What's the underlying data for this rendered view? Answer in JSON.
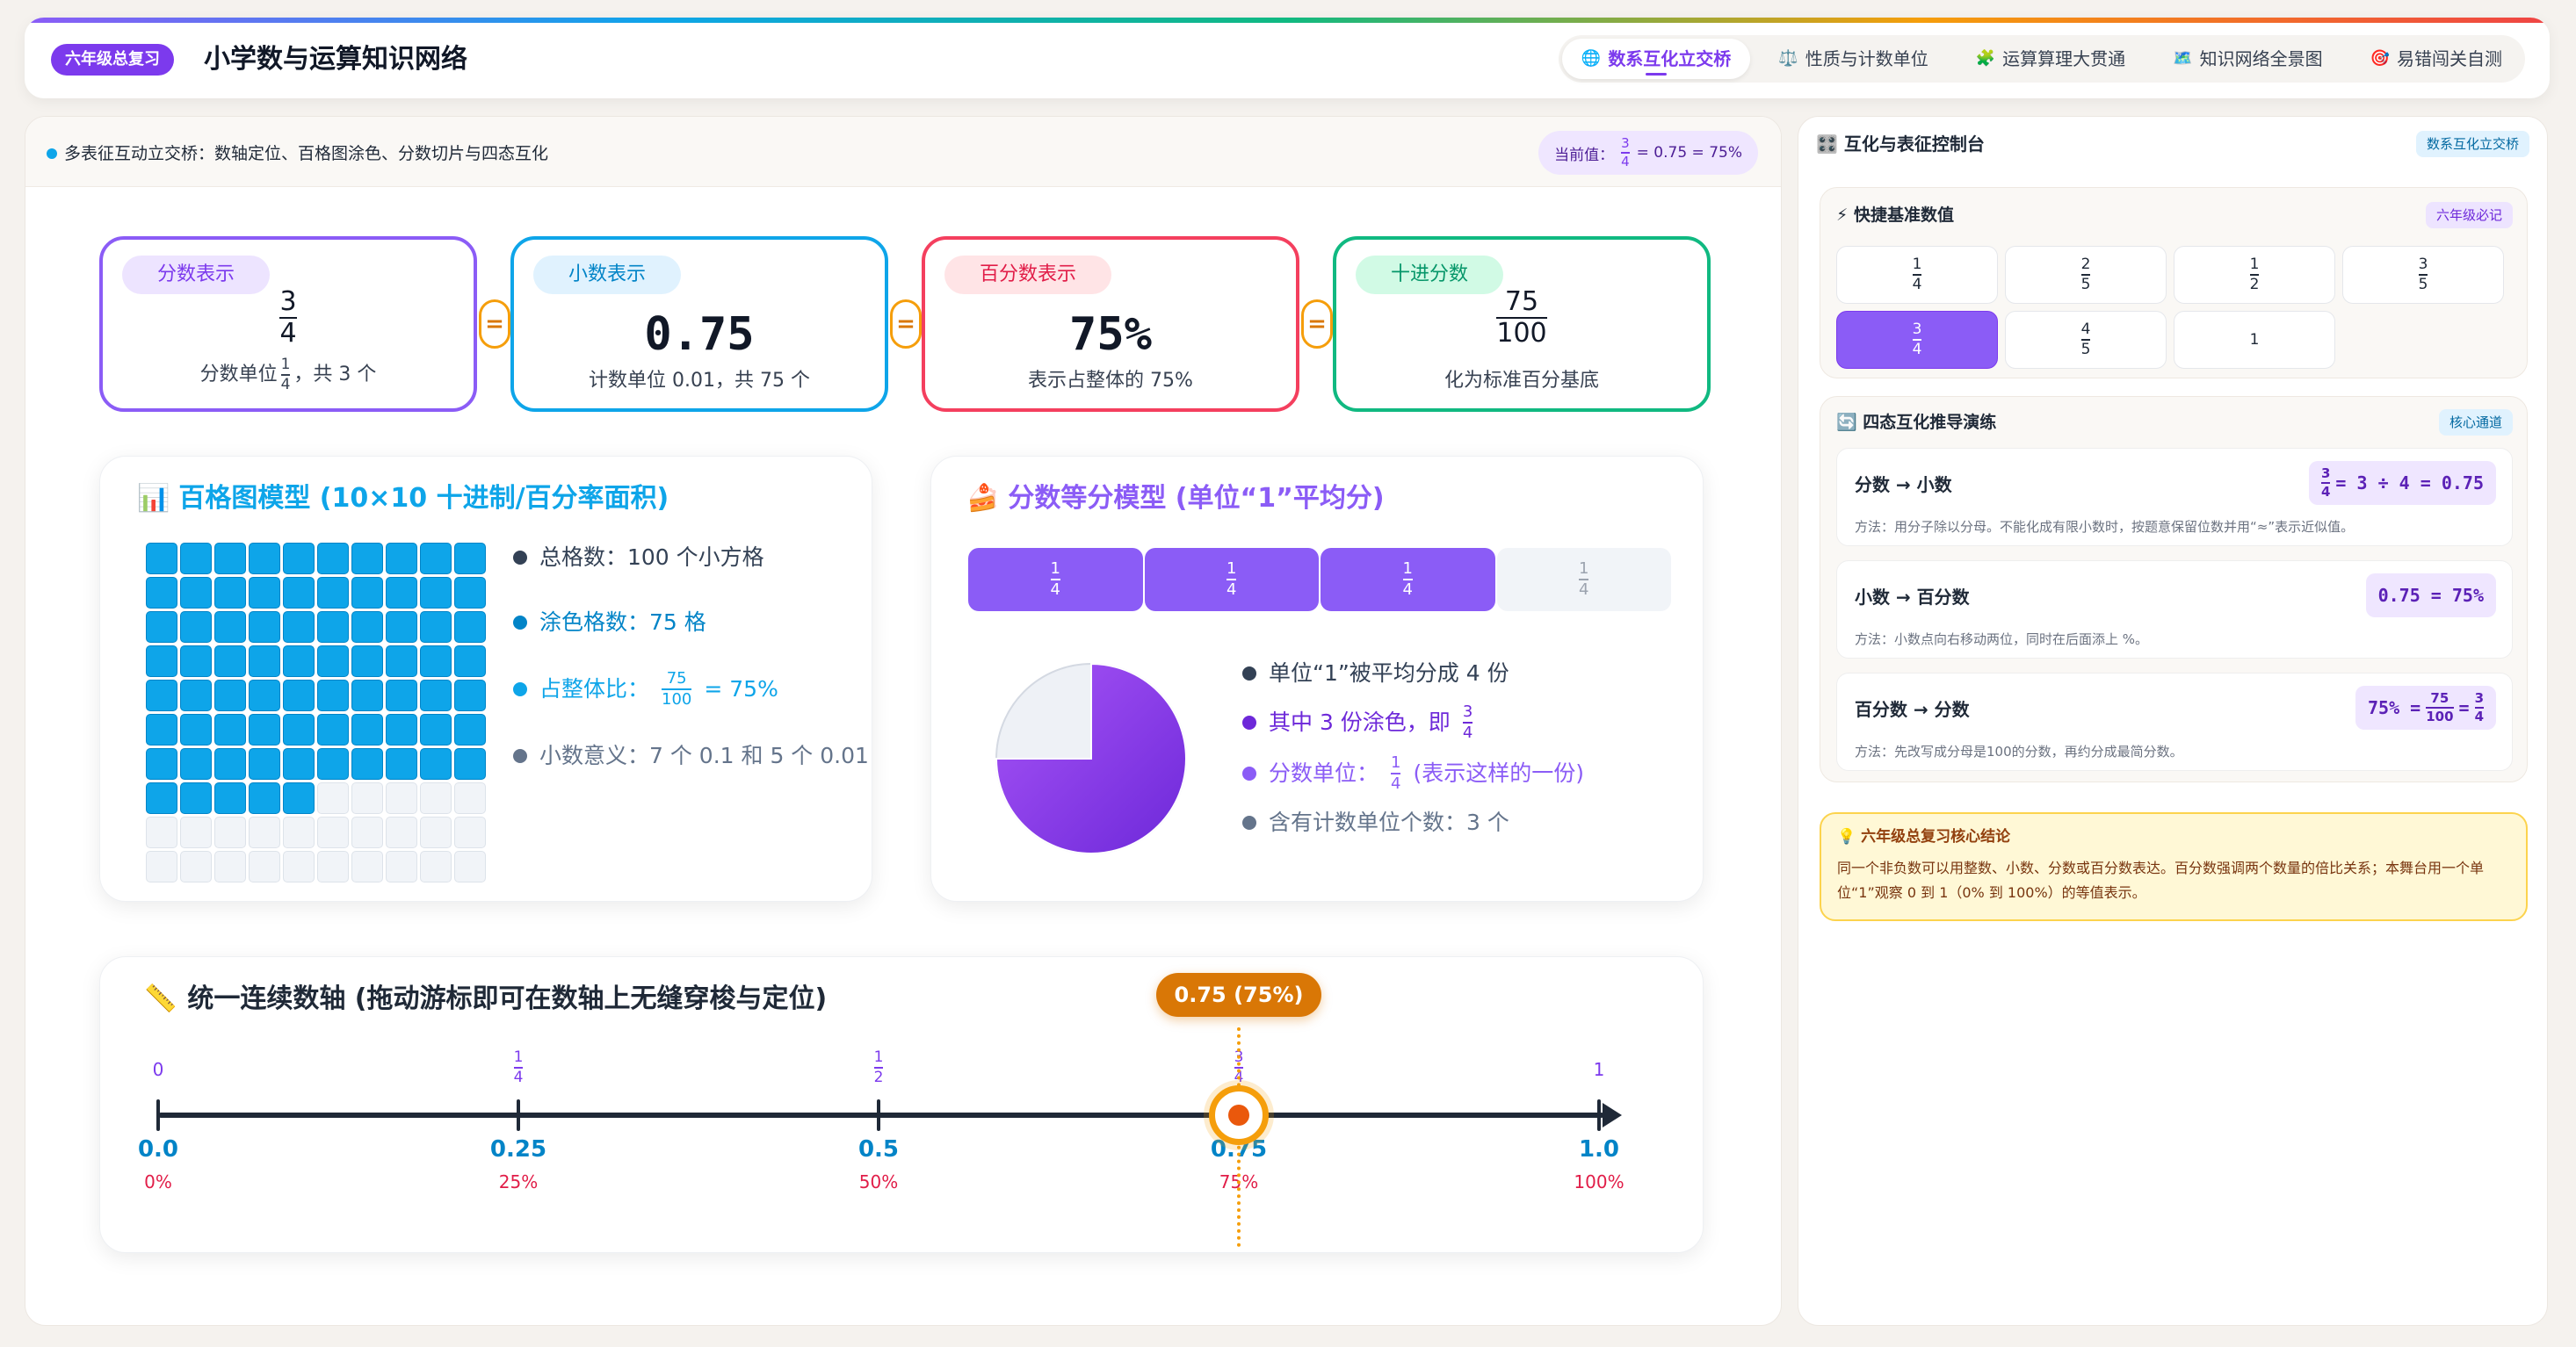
{
  "header": {
    "badge": "六年级总复习",
    "title": "小学数与运算知识网络",
    "tabs": [
      {
        "label": "数系互化立交桥",
        "icon": "globe-icon",
        "glyph": "🌐"
      },
      {
        "label": "性质与计数单位",
        "icon": "scales-icon",
        "glyph": "⚖️"
      },
      {
        "label": "运算算理大贯通",
        "icon": "puzzle-icon",
        "glyph": "🧩"
      },
      {
        "label": "知识网络全景图",
        "icon": "map-icon",
        "glyph": "🗺️"
      },
      {
        "label": "易错闯关自测",
        "icon": "target-icon",
        "glyph": "🎯"
      }
    ]
  },
  "left": {
    "header_text": "多表征互动立交桥：数轴定位、百格图涂色、分数切片与四态互化",
    "current": {
      "label": "当前值：",
      "num": "3",
      "den": "4",
      "text": "= 0.75 = 75%"
    },
    "reps": [
      {
        "pill": "分数表示",
        "num": "3",
        "den": "4",
        "sub_pre": "分数单位",
        "sub_num": "1",
        "sub_den": "4",
        "sub_post": "，共 3 个",
        "color": "#8b5cf6",
        "pillbg": "#ede4ff",
        "pillfg": "#7c3aed"
      },
      {
        "pill": "小数表示",
        "value": "0.75",
        "sub": "计数单位 0.01，共 75 个",
        "color": "#0ea5e9",
        "pillbg": "#e0f2fe",
        "pillfg": "#0284c7"
      },
      {
        "pill": "百分数表示",
        "value": "75%",
        "sub": "表示占整体的 75%",
        "color": "#f43f5e",
        "pillbg": "#ffe4e6",
        "pillfg": "#e11d48"
      },
      {
        "pill": "十进分数",
        "num": "75",
        "den": "100",
        "sub": "化为标准百分基底",
        "color": "#10b981",
        "pillbg": "#d1fae5",
        "pillfg": "#059669"
      }
    ],
    "eq_sign": "=",
    "hundred": {
      "title": "百格图模型 (10×10 十进制/百分率面积)",
      "icon": "chart-icon",
      "glyph": "📊",
      "filled": 75,
      "items": [
        {
          "text": "总格数：100 个小方格",
          "color": "#334155"
        },
        {
          "text": "涂色格数：75 格",
          "color": "#0284c7"
        },
        {
          "text": "占整体比：",
          "num": "75",
          "den": "100",
          "post": "= 75%",
          "color": "#0ea5e9"
        },
        {
          "text": "小数意义：7 个 0.1 和 5 个 0.01",
          "color": "#64748b"
        }
      ]
    },
    "fraction": {
      "title": "分数等分模型 (单位“1”平均分)",
      "icon": "cake-icon",
      "glyph": "🍰",
      "slices": [
        {
          "num": "1",
          "den": "4",
          "on": true
        },
        {
          "num": "1",
          "den": "4",
          "on": true
        },
        {
          "num": "1",
          "den": "4",
          "on": true
        },
        {
          "num": "1",
          "den": "4",
          "on": false
        }
      ],
      "shaded_fraction": 0.75,
      "items": [
        {
          "text": "单位“1”被平均分成 4 份",
          "color": "#334155"
        },
        {
          "text": "其中 3 份涂色，即",
          "num": "3",
          "den": "4",
          "color": "#6d28d9"
        },
        {
          "text": "分数单位：",
          "num": "1",
          "den": "4",
          "post": "(表示这样的一份)",
          "color": "#8b5cf6"
        },
        {
          "text": "含有计数单位个数：3 个",
          "color": "#64748b"
        }
      ]
    },
    "axis": {
      "title": "统一连续数轴 (拖动游标即可在数轴上无缝穿梭与定位)",
      "icon": "ruler-icon",
      "glyph": "📏",
      "cursor_label": "0.75 (75%)",
      "cursor_value": 0.75,
      "ticks": [
        {
          "v": 0,
          "frac": "0",
          "dec": "0.0",
          "pct": "0%"
        },
        {
          "v": 0.25,
          "num": "1",
          "den": "4",
          "dec": "0.25",
          "pct": "25%"
        },
        {
          "v": 0.5,
          "num": "1",
          "den": "2",
          "dec": "0.5",
          "pct": "50%"
        },
        {
          "v": 0.75,
          "num": "3",
          "den": "4",
          "dec": "0.75",
          "pct": "75%"
        },
        {
          "v": 1,
          "frac": "1",
          "dec": "1.0",
          "pct": "100%"
        }
      ]
    }
  },
  "right": {
    "title": "互化与表征控制台",
    "icon": "grid-icon",
    "glyph": "🎛️",
    "tag": "数系互化立交桥",
    "quick": {
      "title": "快捷基准数值",
      "icon": "bolt-icon",
      "glyph": "⚡",
      "tag": "六年级必记",
      "buttons": [
        {
          "num": "1",
          "den": "4"
        },
        {
          "num": "2",
          "den": "5"
        },
        {
          "num": "1",
          "den": "2"
        },
        {
          "num": "3",
          "den": "5"
        },
        {
          "num": "3",
          "den": "4",
          "selected": true
        },
        {
          "num": "4",
          "den": "5"
        },
        {
          "text": "1"
        }
      ]
    },
    "drill": {
      "title": "四态互化推导演练",
      "icon": "refresh-icon",
      "glyph": "🔄",
      "tag": "核心通道",
      "rows": [
        {
          "label": "分数 → 小数",
          "num": "3",
          "den": "4",
          "result": "= 3 ÷ 4 = 0.75",
          "method": "方法：用分子除以分母。不能化成有限小数时，按题意保留位数并用“≈”表示近似值。"
        },
        {
          "label": "小数 → 百分数",
          "result": "0.75 = 75%",
          "method": "方法：小数点向右移动两位，同时在后面添上 %。"
        },
        {
          "label": "百分数 → 分数",
          "pre": "75% =",
          "num": "75",
          "den": "100",
          "mid": "=",
          "num2": "3",
          "den2": "4",
          "method": "方法：先改写成分母是100的分数，再约分成最简分数。"
        }
      ]
    },
    "conclusion": {
      "title": "六年级总复习核心结论",
      "icon": "bulb-icon",
      "glyph": "💡",
      "text": "同一个非负数可以用整数、小数、分数或百分数表达。百分数强调两个数量的倍比关系；本舞台用一个单位“1”观察 0 到 1（0% 到 100%）的等值表示。"
    }
  }
}
